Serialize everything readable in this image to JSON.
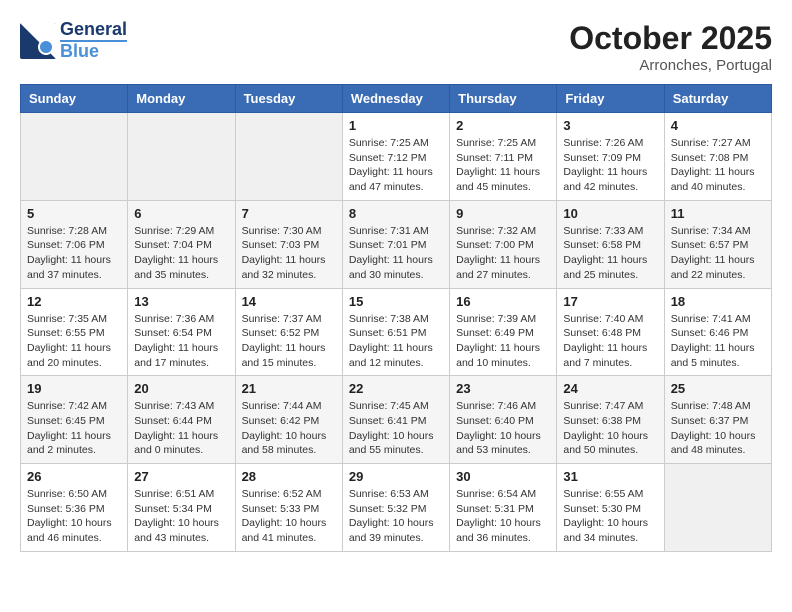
{
  "logo": {
    "line1": "General",
    "line2": "Blue"
  },
  "title": "October 2025",
  "location": "Arronches, Portugal",
  "days_header": [
    "Sunday",
    "Monday",
    "Tuesday",
    "Wednesday",
    "Thursday",
    "Friday",
    "Saturday"
  ],
  "weeks": [
    [
      {
        "day": "",
        "info": ""
      },
      {
        "day": "",
        "info": ""
      },
      {
        "day": "",
        "info": ""
      },
      {
        "day": "1",
        "info": "Sunrise: 7:25 AM\nSunset: 7:12 PM\nDaylight: 11 hours\nand 47 minutes."
      },
      {
        "day": "2",
        "info": "Sunrise: 7:25 AM\nSunset: 7:11 PM\nDaylight: 11 hours\nand 45 minutes."
      },
      {
        "day": "3",
        "info": "Sunrise: 7:26 AM\nSunset: 7:09 PM\nDaylight: 11 hours\nand 42 minutes."
      },
      {
        "day": "4",
        "info": "Sunrise: 7:27 AM\nSunset: 7:08 PM\nDaylight: 11 hours\nand 40 minutes."
      }
    ],
    [
      {
        "day": "5",
        "info": "Sunrise: 7:28 AM\nSunset: 7:06 PM\nDaylight: 11 hours\nand 37 minutes."
      },
      {
        "day": "6",
        "info": "Sunrise: 7:29 AM\nSunset: 7:04 PM\nDaylight: 11 hours\nand 35 minutes."
      },
      {
        "day": "7",
        "info": "Sunrise: 7:30 AM\nSunset: 7:03 PM\nDaylight: 11 hours\nand 32 minutes."
      },
      {
        "day": "8",
        "info": "Sunrise: 7:31 AM\nSunset: 7:01 PM\nDaylight: 11 hours\nand 30 minutes."
      },
      {
        "day": "9",
        "info": "Sunrise: 7:32 AM\nSunset: 7:00 PM\nDaylight: 11 hours\nand 27 minutes."
      },
      {
        "day": "10",
        "info": "Sunrise: 7:33 AM\nSunset: 6:58 PM\nDaylight: 11 hours\nand 25 minutes."
      },
      {
        "day": "11",
        "info": "Sunrise: 7:34 AM\nSunset: 6:57 PM\nDaylight: 11 hours\nand 22 minutes."
      }
    ],
    [
      {
        "day": "12",
        "info": "Sunrise: 7:35 AM\nSunset: 6:55 PM\nDaylight: 11 hours\nand 20 minutes."
      },
      {
        "day": "13",
        "info": "Sunrise: 7:36 AM\nSunset: 6:54 PM\nDaylight: 11 hours\nand 17 minutes."
      },
      {
        "day": "14",
        "info": "Sunrise: 7:37 AM\nSunset: 6:52 PM\nDaylight: 11 hours\nand 15 minutes."
      },
      {
        "day": "15",
        "info": "Sunrise: 7:38 AM\nSunset: 6:51 PM\nDaylight: 11 hours\nand 12 minutes."
      },
      {
        "day": "16",
        "info": "Sunrise: 7:39 AM\nSunset: 6:49 PM\nDaylight: 11 hours\nand 10 minutes."
      },
      {
        "day": "17",
        "info": "Sunrise: 7:40 AM\nSunset: 6:48 PM\nDaylight: 11 hours\nand 7 minutes."
      },
      {
        "day": "18",
        "info": "Sunrise: 7:41 AM\nSunset: 6:46 PM\nDaylight: 11 hours\nand 5 minutes."
      }
    ],
    [
      {
        "day": "19",
        "info": "Sunrise: 7:42 AM\nSunset: 6:45 PM\nDaylight: 11 hours\nand 2 minutes."
      },
      {
        "day": "20",
        "info": "Sunrise: 7:43 AM\nSunset: 6:44 PM\nDaylight: 11 hours\nand 0 minutes."
      },
      {
        "day": "21",
        "info": "Sunrise: 7:44 AM\nSunset: 6:42 PM\nDaylight: 10 hours\nand 58 minutes."
      },
      {
        "day": "22",
        "info": "Sunrise: 7:45 AM\nSunset: 6:41 PM\nDaylight: 10 hours\nand 55 minutes."
      },
      {
        "day": "23",
        "info": "Sunrise: 7:46 AM\nSunset: 6:40 PM\nDaylight: 10 hours\nand 53 minutes."
      },
      {
        "day": "24",
        "info": "Sunrise: 7:47 AM\nSunset: 6:38 PM\nDaylight: 10 hours\nand 50 minutes."
      },
      {
        "day": "25",
        "info": "Sunrise: 7:48 AM\nSunset: 6:37 PM\nDaylight: 10 hours\nand 48 minutes."
      }
    ],
    [
      {
        "day": "26",
        "info": "Sunrise: 6:50 AM\nSunset: 5:36 PM\nDaylight: 10 hours\nand 46 minutes."
      },
      {
        "day": "27",
        "info": "Sunrise: 6:51 AM\nSunset: 5:34 PM\nDaylight: 10 hours\nand 43 minutes."
      },
      {
        "day": "28",
        "info": "Sunrise: 6:52 AM\nSunset: 5:33 PM\nDaylight: 10 hours\nand 41 minutes."
      },
      {
        "day": "29",
        "info": "Sunrise: 6:53 AM\nSunset: 5:32 PM\nDaylight: 10 hours\nand 39 minutes."
      },
      {
        "day": "30",
        "info": "Sunrise: 6:54 AM\nSunset: 5:31 PM\nDaylight: 10 hours\nand 36 minutes."
      },
      {
        "day": "31",
        "info": "Sunrise: 6:55 AM\nSunset: 5:30 PM\nDaylight: 10 hours\nand 34 minutes."
      },
      {
        "day": "",
        "info": ""
      }
    ]
  ]
}
